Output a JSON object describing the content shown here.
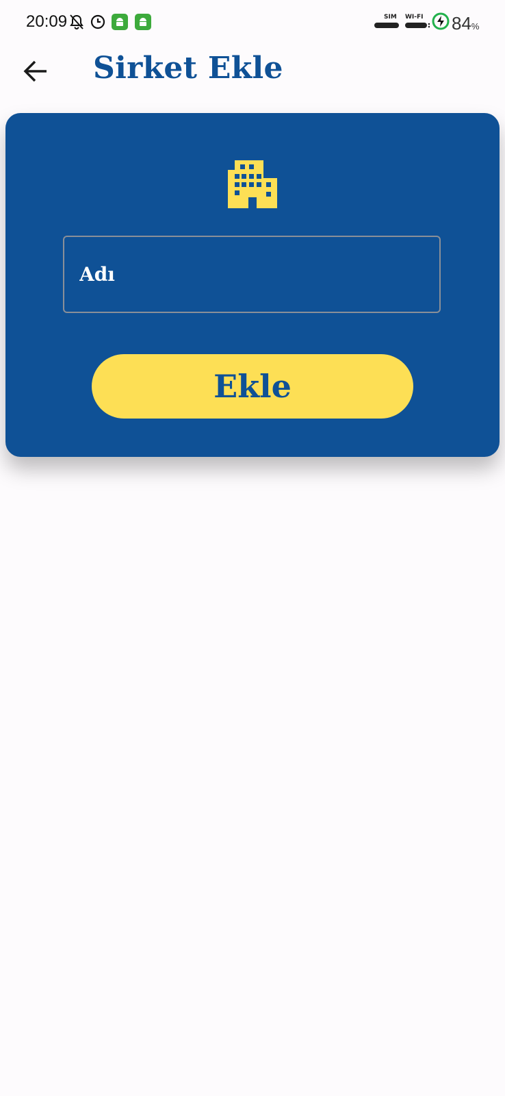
{
  "status_bar": {
    "time": "20:09",
    "sim_label": "SIM",
    "wifi_label": "WI-FI",
    "battery": "84",
    "battery_unit": "%",
    "icons": [
      "bell-off-icon",
      "alarm-clock-icon",
      "android-app-icon",
      "android-app-icon",
      "sim-signal-icon",
      "wifi-signal-icon",
      "battery-charging-icon"
    ]
  },
  "header": {
    "back_icon": "arrow-left-icon",
    "title": "Sirket Ekle"
  },
  "form": {
    "icon": "building-icon",
    "name_placeholder": "Adı",
    "name_value": "",
    "submit_label": "Ekle"
  },
  "colors": {
    "primary": "#0f5196",
    "accent": "#fddf55",
    "background": "#fdfbfd"
  }
}
